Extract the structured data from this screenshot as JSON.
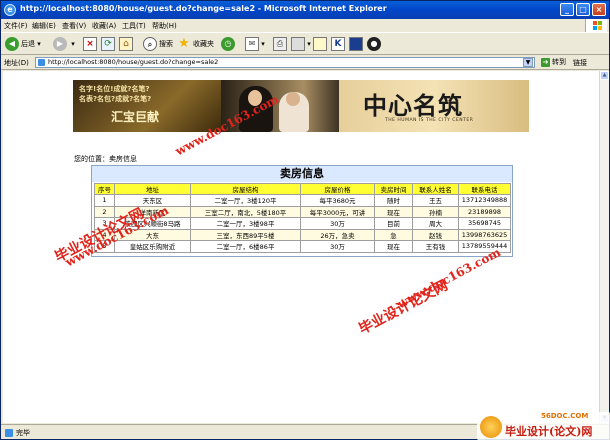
{
  "window": {
    "title": "http://localhost:8080/house/guest.do?change=sale2 - Microsoft Internet Explorer"
  },
  "menu": [
    "文件(F)",
    "编辑(E)",
    "查看(V)",
    "收藏(A)",
    "工具(T)",
    "帮助(H)"
  ],
  "toolbar": {
    "back_label": "后退",
    "search_label": "搜索",
    "favorites_label": "收藏夹"
  },
  "address": {
    "label": "地址(D)",
    "url": "http://localhost:8080/house/guest.do?change=sale2",
    "go_label": "转到",
    "links_label": "链接"
  },
  "banner": {
    "left_line1": "名字!名位!成就?名笔?",
    "left_line2": "名表?名包?成就?名笔?",
    "left_big": "汇宝巨献",
    "right_big": "中心名筑",
    "right_sub": "THE HUMAN IS THE CITY CENTER"
  },
  "page": {
    "location": "您的位置：卖房信息",
    "table_title": "卖房信息"
  },
  "table": {
    "headers": [
      "序号",
      "地址",
      "房屋结构",
      "房屋价格",
      "卖房时间",
      "联系人姓名",
      "联系电话"
    ],
    "rows": [
      [
        "1",
        "天东区",
        "二室一厅，3楼120平",
        "每平3680元",
        "随时",
        "王五",
        "13712349888"
      ],
      [
        "2",
        "洋南新区",
        "三室二厅，南北，5楼180平",
        "每平3000元，可讲",
        "现在",
        "孙楠",
        "23189898"
      ],
      [
        "3",
        "铁西区兴顺街8马路",
        "二室一厅，3楼98平",
        "30万",
        "目前",
        "周大",
        "35698745"
      ],
      [
        "4",
        "大东",
        "三室，东西89平5楼",
        "26万，急卖",
        "急",
        "赵钱",
        "13998763625"
      ],
      [
        "5",
        "皇姑区乐购附近",
        "二室一厅，6楼86平",
        "30万",
        "现在",
        "王有钱",
        "13789559444"
      ]
    ]
  },
  "watermarks": {
    "cn": "毕业设计论文网",
    "url": "www.doc163.com"
  },
  "status": {
    "text": "完毕"
  },
  "brand_logo": {
    "top": "56DOC.COM",
    "text": "毕业设计(论文)网"
  }
}
